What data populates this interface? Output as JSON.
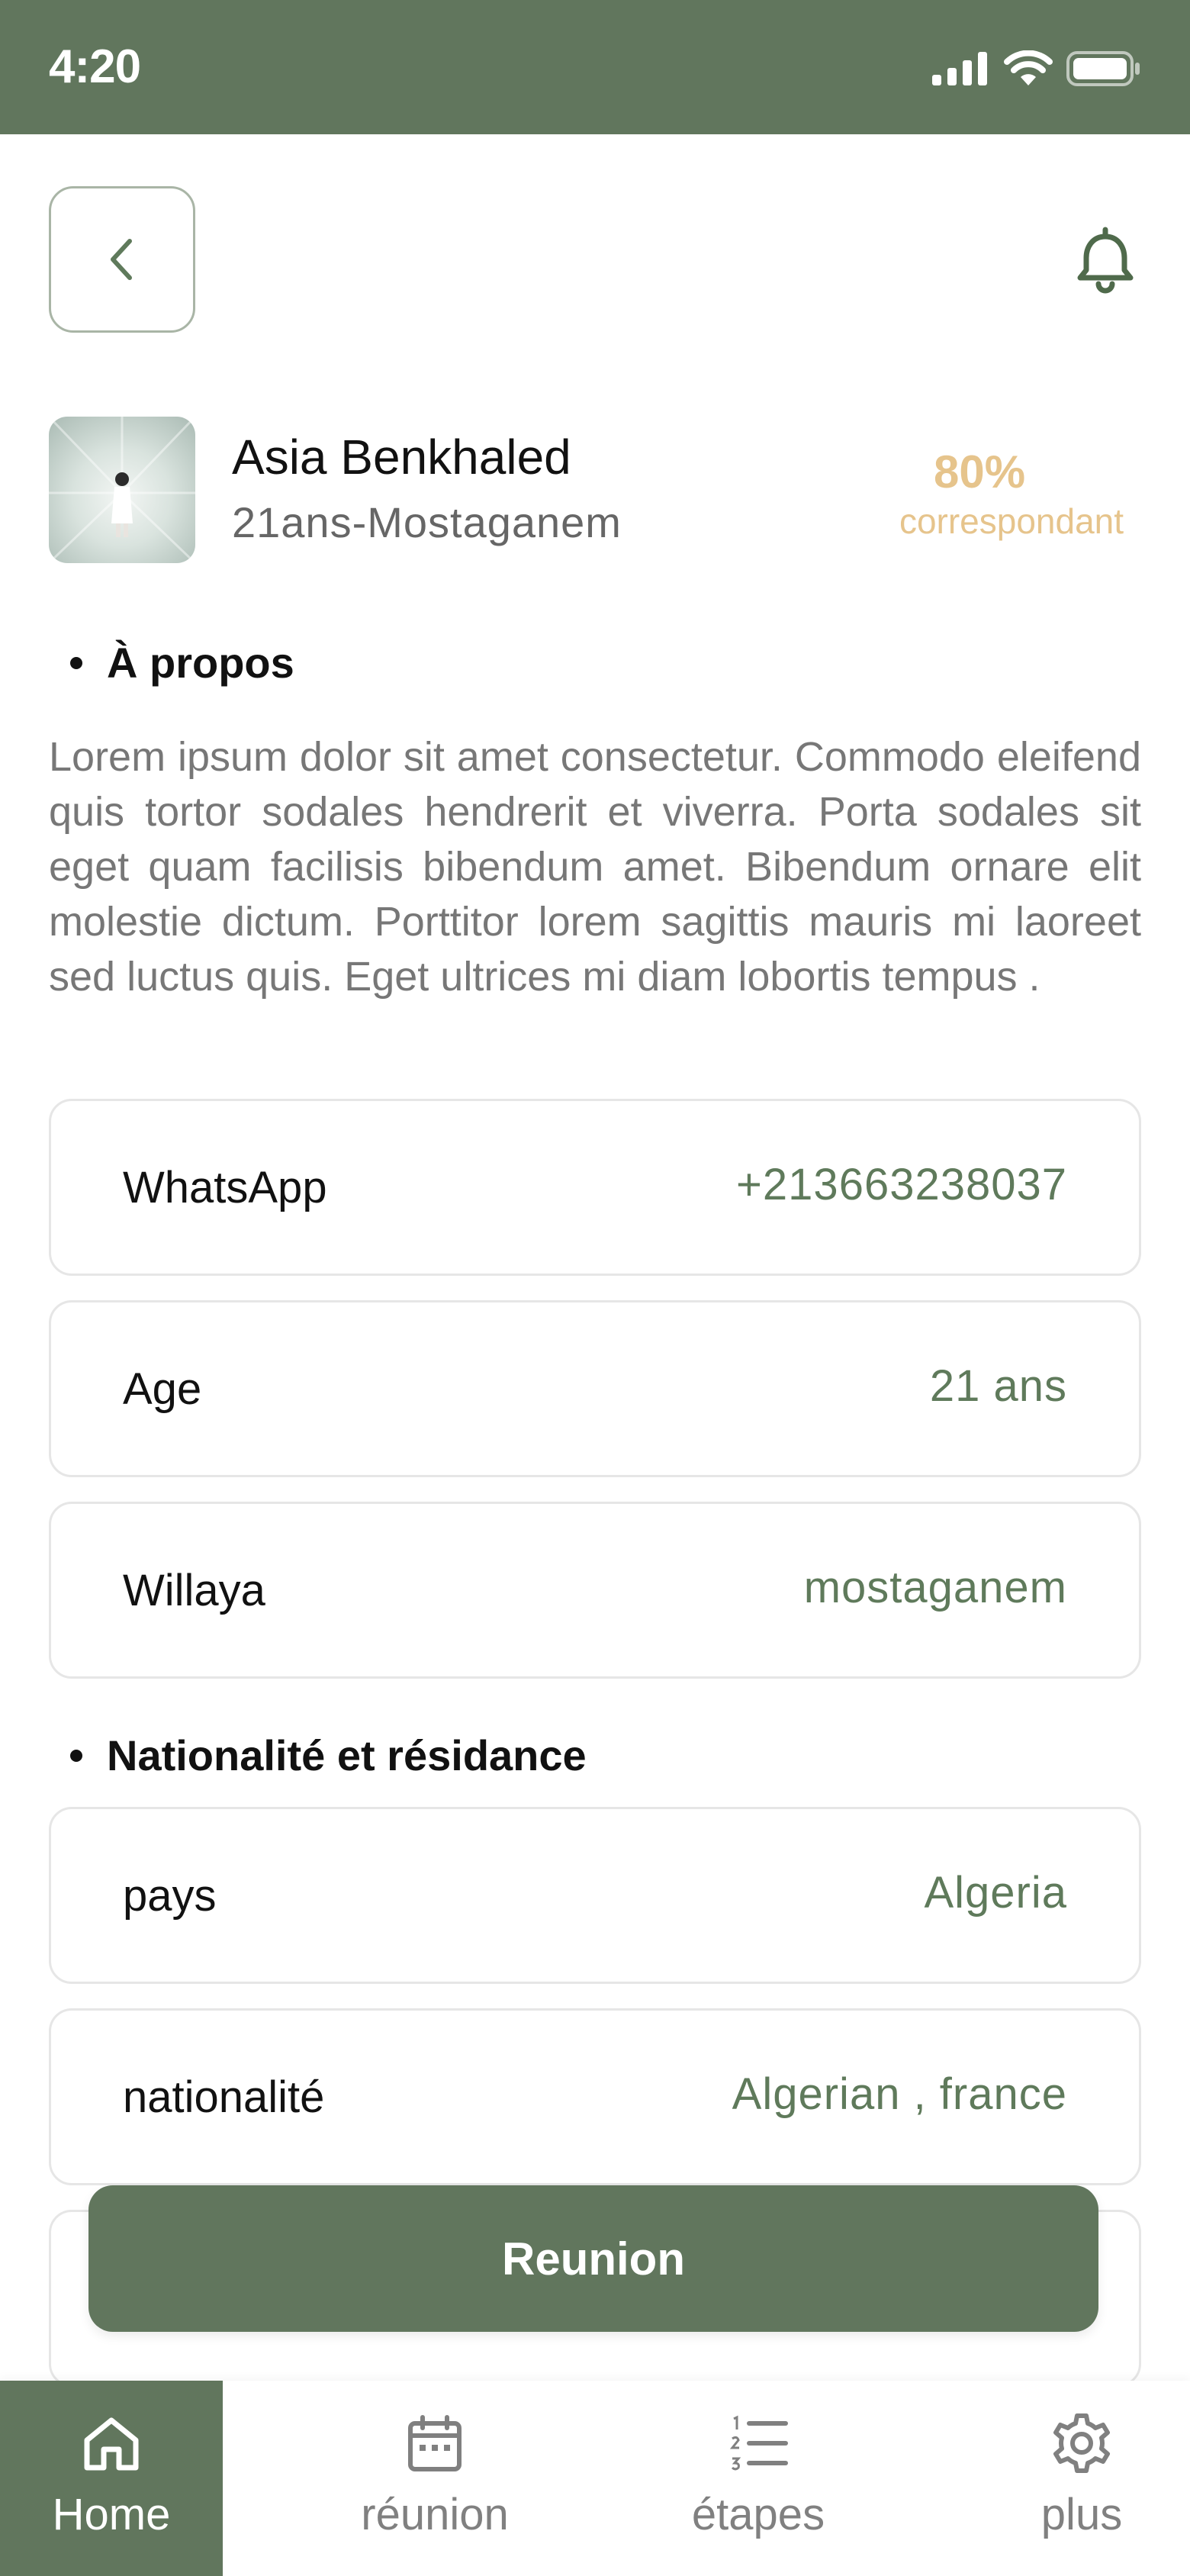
{
  "status_bar": {
    "time": "4:20"
  },
  "header": {
    "back_icon": "chevron-left-icon",
    "notification_icon": "bell-icon"
  },
  "profile": {
    "name": "Asia Benkhaled",
    "subtitle": "21ans-Mostaganem",
    "match_percent": "80%",
    "match_label": "correspondant"
  },
  "about": {
    "title": "À propos",
    "text": "Lorem ipsum dolor sit amet consectetur. Commodo eleifend quis tortor sodales hendrerit et viverra. Porta sodales sit eget quam facilisis bibendum amet. Bibendum ornare elit molestie dictum. Porttitor lorem sagittis mauris mi laoreet sed luctus quis. Eget ultrices mi diam lobortis tempus ."
  },
  "details": [
    {
      "label": "WhatsApp",
      "value": "+213663238037"
    },
    {
      "label": "Age",
      "value": "21 ans"
    },
    {
      "label": "Willaya",
      "value": "mostaganem"
    }
  ],
  "nationality": {
    "title": "Nationalité et résidance",
    "rows": [
      {
        "label": "pays",
        "value": "Algeria"
      },
      {
        "label": "nationalité",
        "value": "Algerian , france"
      }
    ]
  },
  "reunion_button": {
    "label": "Reunion"
  },
  "bottom_nav": [
    {
      "label": "Home",
      "icon": "home-icon",
      "active": true
    },
    {
      "label": "réunion",
      "icon": "calendar-icon",
      "active": false
    },
    {
      "label": "étapes",
      "icon": "numbered-list-icon",
      "active": false
    },
    {
      "label": "plus",
      "icon": "gear-icon",
      "active": false
    }
  ],
  "colors": {
    "primary": "#61765d",
    "accent": "#e6c48c",
    "value_text": "#5f7a5b"
  }
}
